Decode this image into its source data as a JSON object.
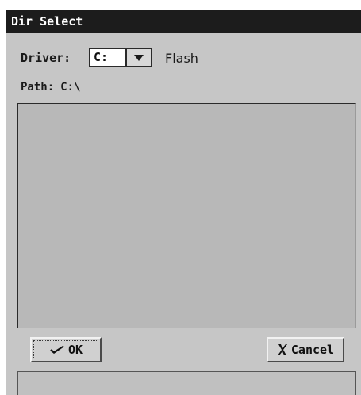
{
  "window": {
    "title": "Dir Select"
  },
  "driver": {
    "label": "Driver:",
    "selected": "C:",
    "drive_name": "Flash"
  },
  "path": {
    "label": "Path:",
    "value": "C:\\"
  },
  "buttons": {
    "ok_label": "OK",
    "cancel_label": "Cancel"
  },
  "icons": {
    "dropdown": "chevron-down-icon",
    "ok": "checkmark-icon",
    "cancel": "cross-icon"
  },
  "colors": {
    "titlebar": "#1c1c1c",
    "window_bg": "#c6c6c6",
    "list_bg": "#b8b8b8"
  }
}
